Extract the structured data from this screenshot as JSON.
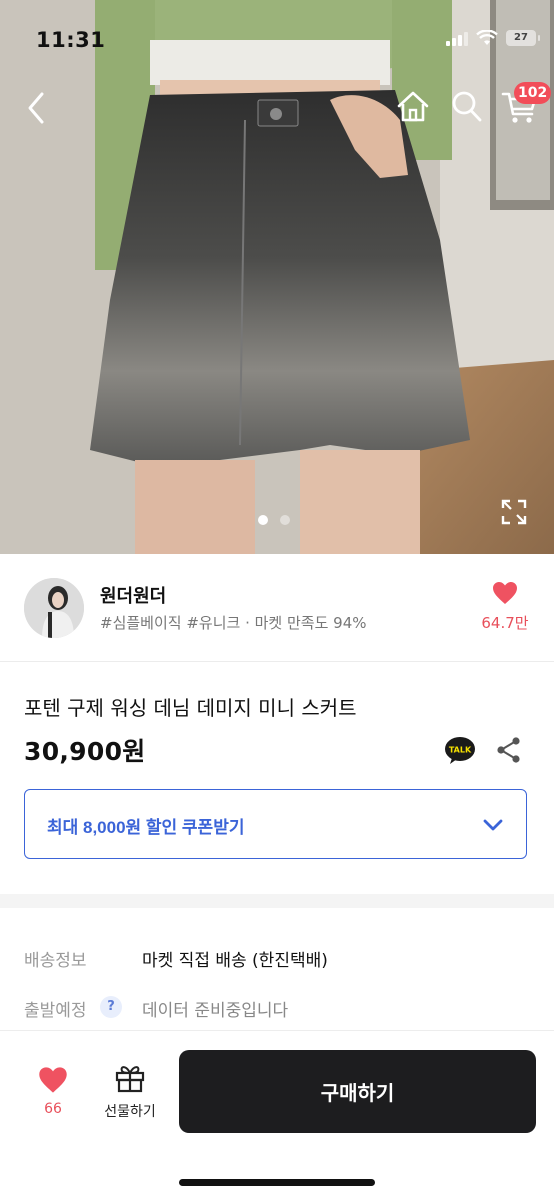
{
  "status_bar": {
    "time": "11:31",
    "battery": "27"
  },
  "header": {
    "back_icon": "chevron-left-icon",
    "home_icon": "home-icon",
    "search_icon": "search-icon",
    "cart_icon": "cart-icon",
    "cart_badge": "102"
  },
  "gallery": {
    "total": 2,
    "current": 1,
    "expand_icon": "expand-icon"
  },
  "seller": {
    "name": "원더원더",
    "tags": "#심플베이직 #유니크 · 마켓 만족도 94%",
    "like_count": "64.7만"
  },
  "product": {
    "title": "포텐 구제 워싱 데님 데미지 미니 스커트",
    "price": "30,900원",
    "talk_label": "TALK"
  },
  "coupon": {
    "label": "최대 8,000원 할인 쿠폰받기"
  },
  "shipping": {
    "delivery_label": "배송정보",
    "delivery_value": "마켓 직접 배송 (한진택배)",
    "departure_label": "출발예정",
    "help_mark": "?",
    "departure_value": "데이터 준비중입니다"
  },
  "bottom_bar": {
    "fav_count": "66",
    "gift_label": "선물하기",
    "buy_label": "구매하기"
  },
  "colors": {
    "accent_blue": "#3b64d8",
    "heart_red": "#e8505b",
    "badge_red": "#f24d59",
    "buy_button": "#1d1d1f"
  }
}
